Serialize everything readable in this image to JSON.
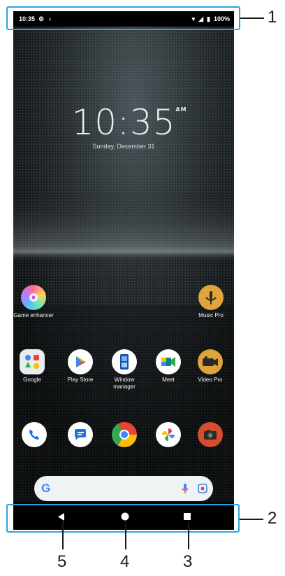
{
  "status_bar": {
    "time": "10:35",
    "battery": "100%"
  },
  "clock": {
    "time": "10:35",
    "ampm": "AM",
    "date": "Sunday, December 31"
  },
  "apps": {
    "game_enhancer": "Game enhancer",
    "music_pro": "Music Pro",
    "google": "Google",
    "play_store": "Play Store",
    "window_manager": "Window manager",
    "meet": "Meet",
    "video_pro": "Video Pro"
  },
  "dock": [
    "phone-icon",
    "messages-icon",
    "chrome-icon",
    "photos-icon",
    "camera-icon"
  ],
  "search": {
    "logo": "G"
  },
  "callouts": {
    "c1": "1",
    "c2": "2",
    "c3": "3",
    "c4": "4",
    "c5": "5"
  },
  "colors": {
    "callout": "#2da3e0",
    "bar": "#000000"
  }
}
